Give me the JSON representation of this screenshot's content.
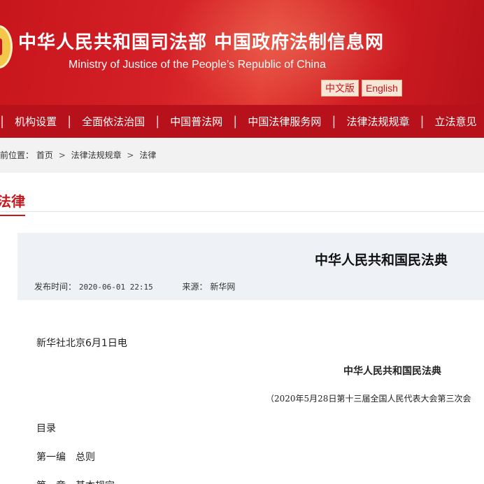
{
  "header": {
    "title": "中华人民共和国司法部  中国政府法制信息网",
    "subtitle": "Ministry of Justice of the People’s Republic of China",
    "lang_cn": "中文版",
    "lang_en": "English"
  },
  "nav": {
    "items": [
      "机构设置",
      "全面依法治国",
      "中国普法网",
      "中国法律服务网",
      "法律法规规章",
      "立法意见"
    ]
  },
  "breadcrumb": {
    "prefix": "当前位置：",
    "items": [
      "首页",
      "法律法规规章",
      "法律"
    ],
    "separator": ">"
  },
  "section": {
    "title": "法律"
  },
  "article": {
    "title": "中华人民共和国民法典",
    "publish_label": "发布时间：",
    "publish_time": "2020-06-01 22:15",
    "source_label": "来源：",
    "source": "新华网"
  },
  "body": {
    "dateline": "新华社北京6月1日电",
    "law_title": "中华人民共和国民法典",
    "adoption": "（2020年5月28日第十三届全国人民代表大会第三次会",
    "toc": "目录",
    "part1": "第一编　总则",
    "chapter1": "第一章　基本规定"
  },
  "colors": {
    "brand_red": "#c8161d",
    "nav_red": "#b7121b",
    "info_bg": "#eef2f6"
  }
}
